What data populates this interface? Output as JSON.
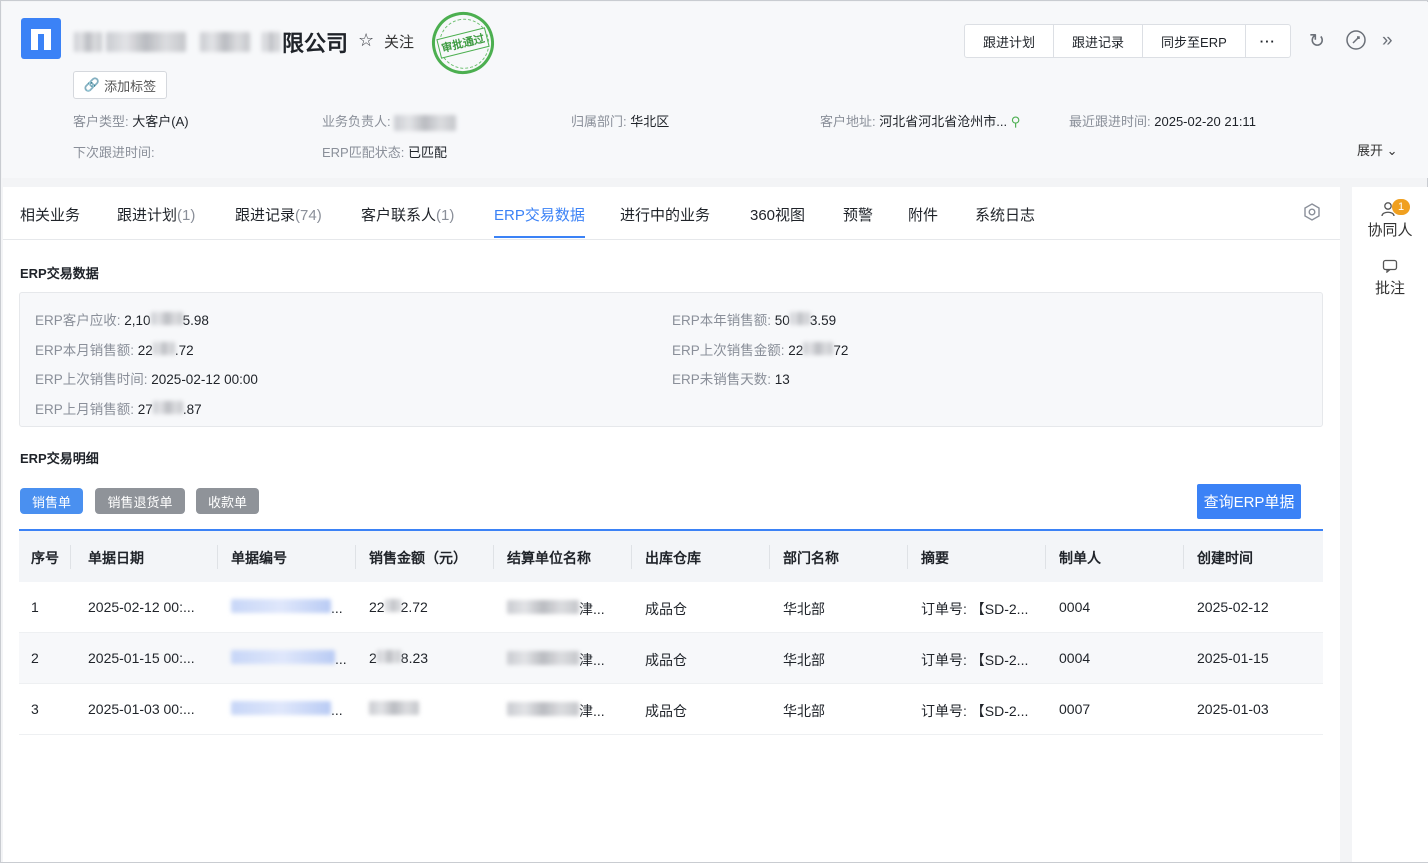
{
  "header": {
    "company_name_suffix": "限公司",
    "follow_label": "关注",
    "stamp_text": "审批通过",
    "add_tag_label": "添加标签",
    "actions": [
      "跟进计划",
      "跟进记录",
      "同步至ERP",
      "···"
    ],
    "icons": [
      "refresh-icon",
      "pin-icon",
      "double-chevron-right-icon"
    ],
    "fields": {
      "customer_type_label": "客户类型:",
      "customer_type_value": "大客户(A)",
      "owner_label": "业务负责人:",
      "department_label": "归属部门:",
      "department_value": "华北区",
      "address_label": "客户地址:",
      "address_value": "河北省河北省沧州市...",
      "last_followup_label": "最近跟进时间:",
      "last_followup_value": "2025-02-20 21:11",
      "next_followup_label": "下次跟进时间:",
      "erp_match_label": "ERP匹配状态:",
      "erp_match_value": "已匹配"
    },
    "expand_label": "展开"
  },
  "tabs": [
    {
      "label": "相关业务",
      "count": ""
    },
    {
      "label": "跟进计划",
      "count": "(1)"
    },
    {
      "label": "跟进记录",
      "count": "(74)"
    },
    {
      "label": "客户联系人",
      "count": "(1)"
    },
    {
      "label": "ERP交易数据",
      "count": ""
    },
    {
      "label": "进行中的业务",
      "count": ""
    },
    {
      "label": "360视图",
      "count": ""
    },
    {
      "label": "预警",
      "count": ""
    },
    {
      "label": "附件",
      "count": ""
    },
    {
      "label": "系统日志",
      "count": ""
    }
  ],
  "active_tab": "ERP交易数据",
  "erp_summary": {
    "title": "ERP交易数据",
    "receivable_label": "ERP客户应收:",
    "receivable_prefix": "2,10",
    "receivable_suffix": "5.98",
    "month_sales_label": "ERP本月销售额:",
    "month_sales_prefix": "22",
    "month_sales_suffix": ".72",
    "last_sale_time_label": "ERP上次销售时间:",
    "last_sale_time_value": "2025-02-12 00:00",
    "last_month_sales_label": "ERP上月销售额:",
    "last_month_sales_prefix": "27",
    "last_month_sales_suffix": ".87",
    "year_sales_label": "ERP本年销售额:",
    "year_sales_prefix": "50",
    "year_sales_suffix": "3.59",
    "last_amount_label": "ERP上次销售金额:",
    "last_amount_prefix": "22",
    "last_amount_suffix": "72",
    "no_sale_days_label": "ERP未销售天数:",
    "no_sale_days_value": "13"
  },
  "detail": {
    "title": "ERP交易明细",
    "filters": [
      {
        "label": "销售单",
        "color": "#4a90f0"
      },
      {
        "label": "销售退货单",
        "color": "#8f9399"
      },
      {
        "label": "收款单",
        "color": "#8f9399"
      }
    ],
    "query_button": "查询ERP单据",
    "columns": [
      "序号",
      "单据日期",
      "单据编号",
      "销售金额（元）",
      "结算单位名称",
      "出库仓库",
      "部门名称",
      "摘要",
      "制单人",
      "创建时间"
    ],
    "rows": [
      {
        "no": "1",
        "date": "2025-02-12 00:...",
        "code_suffix": "...",
        "amount_prefix": "22",
        "amount_suffix": "2.72",
        "unit_suffix": "津...",
        "warehouse": "成品仓",
        "dept": "华北部",
        "summary": "订单号: 【SD-2...",
        "maker": "0004",
        "created": "2025-02-12"
      },
      {
        "no": "2",
        "date": "2025-01-15 00:...",
        "code_suffix": "...",
        "amount_prefix": "2",
        "amount_suffix": "8.23",
        "unit_suffix": "津...",
        "warehouse": "成品仓",
        "dept": "华北部",
        "summary": "订单号: 【SD-2...",
        "maker": "0004",
        "created": "2025-01-15"
      },
      {
        "no": "3",
        "date": "2025-01-03 00:...",
        "code_suffix": "...",
        "amount_prefix": "",
        "amount_suffix": "",
        "unit_suffix": "津...",
        "warehouse": "成品仓",
        "dept": "华北部",
        "summary": "订单号: 【SD-2...",
        "maker": "0007",
        "created": "2025-01-03"
      }
    ]
  },
  "rail": {
    "collaborators_label": "协同人",
    "collaborators_badge": "1",
    "comments_label": "批注"
  },
  "colors": {
    "accent": "#3b82f6",
    "stamp": "#4caf50",
    "badge": "#f0a020"
  }
}
